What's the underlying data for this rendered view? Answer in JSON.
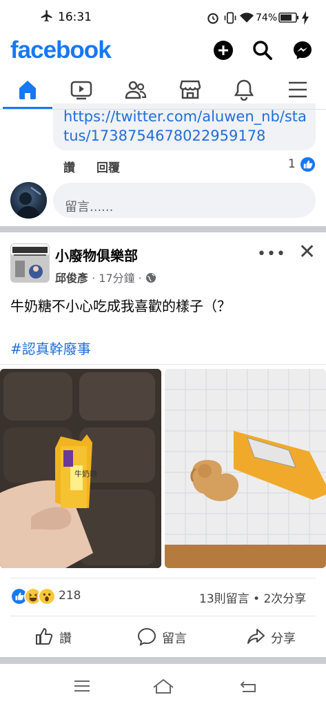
{
  "status_bar": {
    "time": "16:31",
    "battery_pct": "74%",
    "icons": [
      "airplane-icon",
      "alarm-icon",
      "vibrate-icon",
      "wifi-icon",
      "battery-icon",
      "charging-icon"
    ]
  },
  "header": {
    "logo": "facebook",
    "buttons": [
      "create-icon",
      "search-icon",
      "messenger-icon"
    ]
  },
  "tabs": [
    {
      "name": "home",
      "icon": "home-icon",
      "active": true
    },
    {
      "name": "watch",
      "icon": "video-icon",
      "active": false
    },
    {
      "name": "friends",
      "icon": "friends-icon",
      "active": false
    },
    {
      "name": "marketplace",
      "icon": "store-icon",
      "active": false
    },
    {
      "name": "notifications",
      "icon": "bell-icon",
      "active": false
    },
    {
      "name": "menu",
      "icon": "hamburger-icon",
      "active": false
    }
  ],
  "previous_comment": {
    "link_text": "https://twitter.com/aluwen_nb/status/1738754678022959178",
    "like_label": "讚",
    "reply_label": "回覆",
    "reaction_count": "1"
  },
  "comment_input": {
    "placeholder": "留言......"
  },
  "post": {
    "page_name": "小廢物俱樂部",
    "author": "邱俊彥",
    "time": "· 17分鐘 ·",
    "text": "牛奶糖不小心吃成我喜歡的樣子（？",
    "hashtag": "#認真幹廢事",
    "images": [
      {
        "desc_icon": "candy-photo",
        "wrapper_text": "牛奶糖"
      },
      {
        "desc_icon": "dog-shaped-candy-photo"
      }
    ],
    "reaction_count": "218",
    "comments_shares": "13則留言 • 2次分享",
    "actions": {
      "like": "讚",
      "comment": "留言",
      "share": "分享"
    }
  },
  "android_nav": [
    "menu-icon",
    "home-icon",
    "back-icon"
  ],
  "colors": {
    "brand": "#1877f2",
    "link": "#216fdb",
    "muted": "#65676b"
  }
}
